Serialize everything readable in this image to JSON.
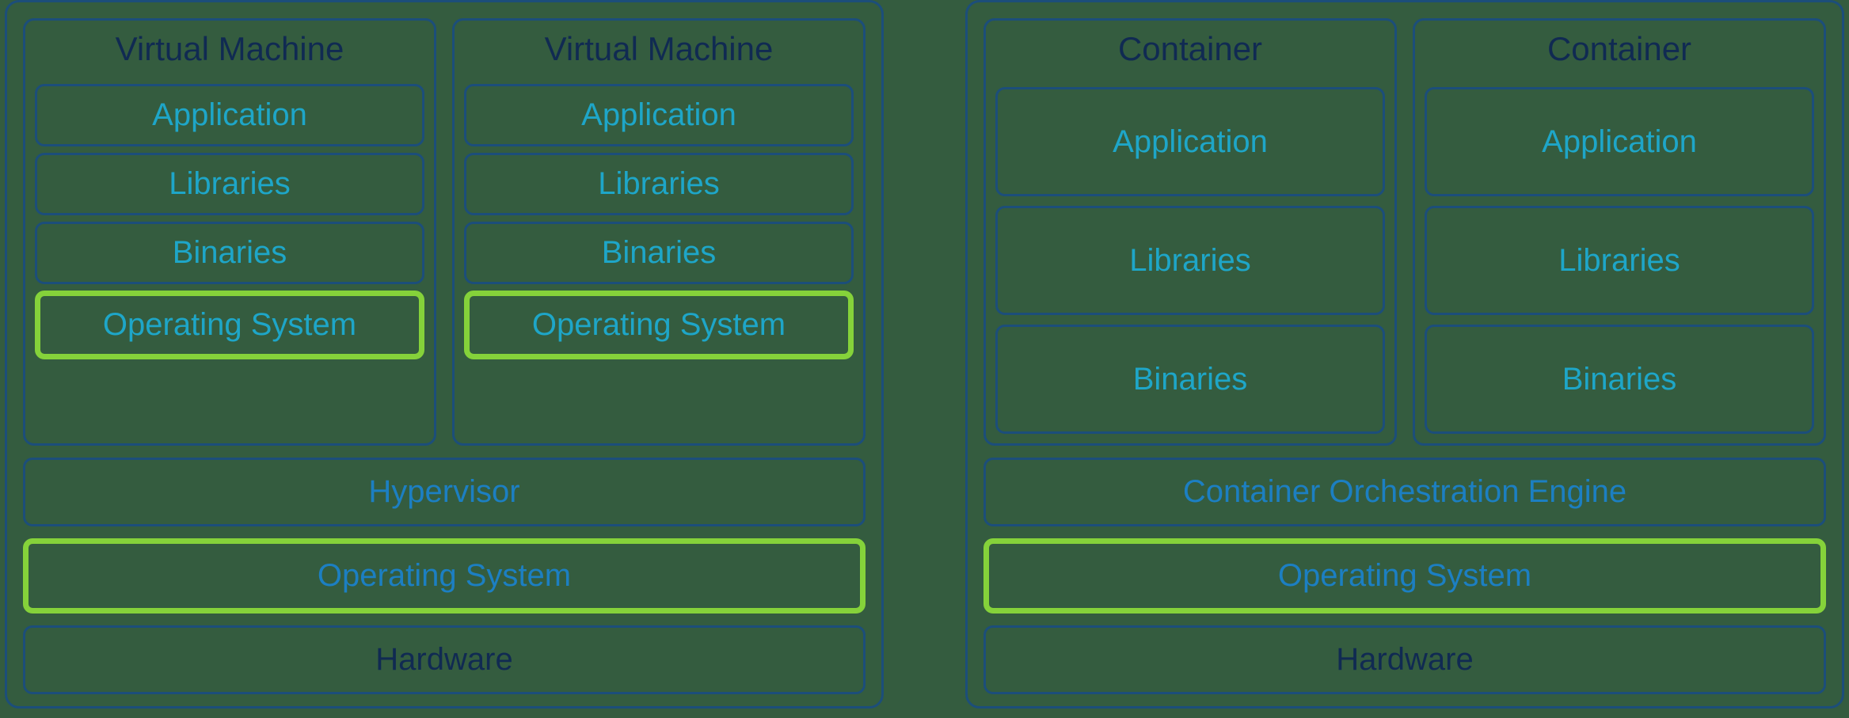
{
  "vm_panel": {
    "units": [
      {
        "title": "Virtual Machine",
        "layers": [
          "Application",
          "Libraries",
          "Binaries",
          "Operating System"
        ]
      },
      {
        "title": "Virtual Machine",
        "layers": [
          "Application",
          "Libraries",
          "Binaries",
          "Operating System"
        ]
      }
    ],
    "hypervisor": "Hypervisor",
    "os": "Operating System",
    "hardware": "Hardware"
  },
  "container_panel": {
    "units": [
      {
        "title": "Container",
        "layers": [
          "Application",
          "Libraries",
          "Binaries"
        ]
      },
      {
        "title": "Container",
        "layers": [
          "Application",
          "Libraries",
          "Binaries"
        ]
      }
    ],
    "orchestration": "Container Orchestration Engine",
    "os": "Operating System",
    "hardware": "Hardware"
  }
}
